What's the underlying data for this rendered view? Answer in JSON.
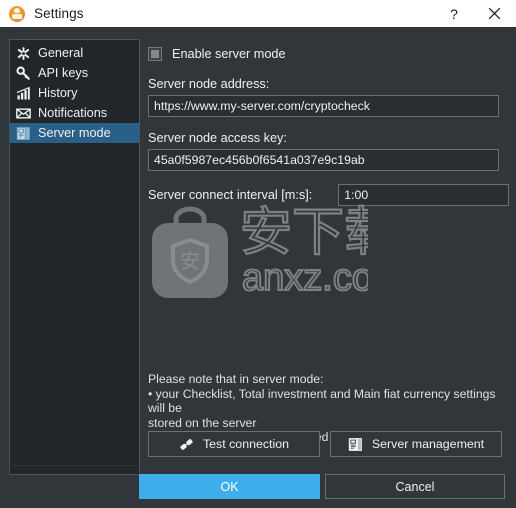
{
  "window": {
    "title": "Settings",
    "app_icon": "crypto-coin-icon",
    "help_button": "?",
    "close_button": "×",
    "background_color": "#31363b",
    "accent_color": "#3daee9"
  },
  "sidebar": {
    "items": [
      {
        "label": "General",
        "icon": "gear-asterisk-icon",
        "selected": false
      },
      {
        "label": "API keys",
        "icon": "key-icon",
        "selected": false
      },
      {
        "label": "History",
        "icon": "bar-chart-icon",
        "selected": false
      },
      {
        "label": "Notifications",
        "icon": "envelope-icon",
        "selected": false
      },
      {
        "label": "Server mode",
        "icon": "server-icon",
        "selected": true
      }
    ],
    "selected_color": "#2a5f87"
  },
  "main": {
    "enable_server_mode": {
      "label": "Enable server mode",
      "checked": false,
      "state": "partial"
    },
    "node_address": {
      "label": "Server node address:",
      "value": "https://www.my-server.com/cryptocheck",
      "placeholder": ""
    },
    "access_key": {
      "label": "Server node access key:",
      "value": "45a0f5987ec456b0f6541a037e9c19ab",
      "placeholder": ""
    },
    "connect_interval": {
      "label": "Server connect interval [m:s]:",
      "value": "1:00",
      "placeholder": ""
    },
    "note": {
      "line1": "Please note that in server mode:",
      "line2": "• your Checklist, Total investment and Main fiat currency settings will be",
      "line3": "stored on the server",
      "line4": "• Continual check will be disabled"
    },
    "buttons": {
      "test_connection": {
        "label": "Test connection",
        "icon": "plug-connector-icon"
      },
      "server_management": {
        "label": "Server management",
        "icon": "server-icon"
      }
    }
  },
  "watermark": {
    "logo": "briefcase-shield-icon",
    "chinese_text": "安下载",
    "site": "anxz.com"
  },
  "footer": {
    "ok": "OK",
    "cancel": "Cancel"
  }
}
